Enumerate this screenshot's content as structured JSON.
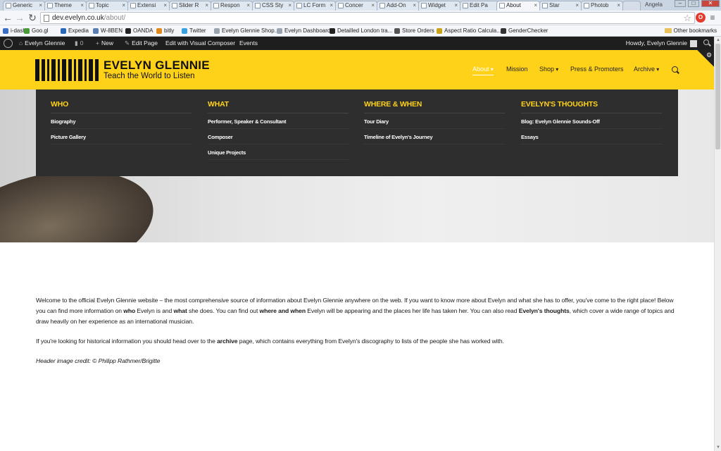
{
  "browser": {
    "tabs": [
      {
        "label": "Generic"
      },
      {
        "label": "Theme"
      },
      {
        "label": "Topic"
      },
      {
        "label": "Extensi"
      },
      {
        "label": "Slider R"
      },
      {
        "label": "Respon"
      },
      {
        "label": "CSS Sty"
      },
      {
        "label": "LC Form"
      },
      {
        "label": "Concer"
      },
      {
        "label": "Add-On"
      },
      {
        "label": "Widget"
      },
      {
        "label": "Edit Pa"
      },
      {
        "label": "About"
      },
      {
        "label": "Star"
      },
      {
        "label": "Photob"
      }
    ],
    "tab_close": "×",
    "profile_name": "Angela",
    "window_controls": [
      "–",
      "□",
      "✕"
    ],
    "url_host": "dev.evelyn.co.uk",
    "url_path": "/about/",
    "bookmarks": [
      "i-dash",
      "Goo.gl",
      "Expedia",
      "W-8BEN",
      "OANDA",
      "bitly",
      "Twitter",
      "Evelyn Glennie Shop...",
      "Evelyn Dashboard",
      "Detailled London tra...",
      "Store Orders",
      "Aspect Ratio Calcula...",
      "GenderChecker"
    ],
    "other_bookmarks": "Other bookmarks"
  },
  "adminbar": {
    "site_name": "Evelyn Glennie",
    "comments_count": "0",
    "new_label": "New",
    "edit_page": "Edit Page",
    "visual_composer": "Edit with Visual Composer",
    "events": "Events",
    "howdy": "Howdy, Evelyn Glennie"
  },
  "header": {
    "logo_title": "EVELYN GLENNIE",
    "logo_tagline": "Teach the World to Listen",
    "nav": [
      {
        "label": "About",
        "active": true,
        "has_dropdown": true
      },
      {
        "label": "Mission",
        "active": false,
        "has_dropdown": false
      },
      {
        "label": "Shop",
        "active": false,
        "has_dropdown": true
      },
      {
        "label": "Press & Promoters",
        "active": false,
        "has_dropdown": false
      },
      {
        "label": "Archive",
        "active": false,
        "has_dropdown": true
      }
    ],
    "brand_color": "#ffd21a"
  },
  "megamenu": {
    "columns": [
      {
        "heading": "WHO",
        "items": [
          "Biography",
          "Picture Gallery"
        ]
      },
      {
        "heading": "WHAT",
        "items": [
          "Performer, Speaker & Consultant",
          "Composer",
          "Unique Projects"
        ]
      },
      {
        "heading": "WHERE & WHEN",
        "items": [
          "Tour Diary",
          "Timeline of Evelyn's Journey"
        ]
      },
      {
        "heading": "EVELYN'S THOUGHTS",
        "items": [
          "Blog: Evelyn Glennie Sounds-Off",
          "Essays"
        ]
      }
    ]
  },
  "content": {
    "intro": {
      "t1": "Welcome to the official Evelyn Glennie website – the most comprehensive source of information about Evelyn Glennie anywhere on the web. If you want to know more about Evelyn and what she has to offer, you've come to the right place! Below you can find more information on ",
      "b1": "who",
      "t2": " Evelyn is and ",
      "b2": "what",
      "t3": " she does. You can find out ",
      "b3": "where and when",
      "t4": " Evelyn will be appearing and the places her life has taken her. You can also read ",
      "b4": "Evelyn's thoughts",
      "t5": ", which cover a wide range of topics and draw heavily on her experience as an international musician."
    },
    "archive": {
      "t1": "If you're looking for historical information you should head over to the ",
      "b1": "archive",
      "t2": " page, which contains everything from Evelyn's discography to lists of the people she has worked with."
    },
    "credit": "Header image credit: © Philipp Rathmer/Brigitte"
  }
}
